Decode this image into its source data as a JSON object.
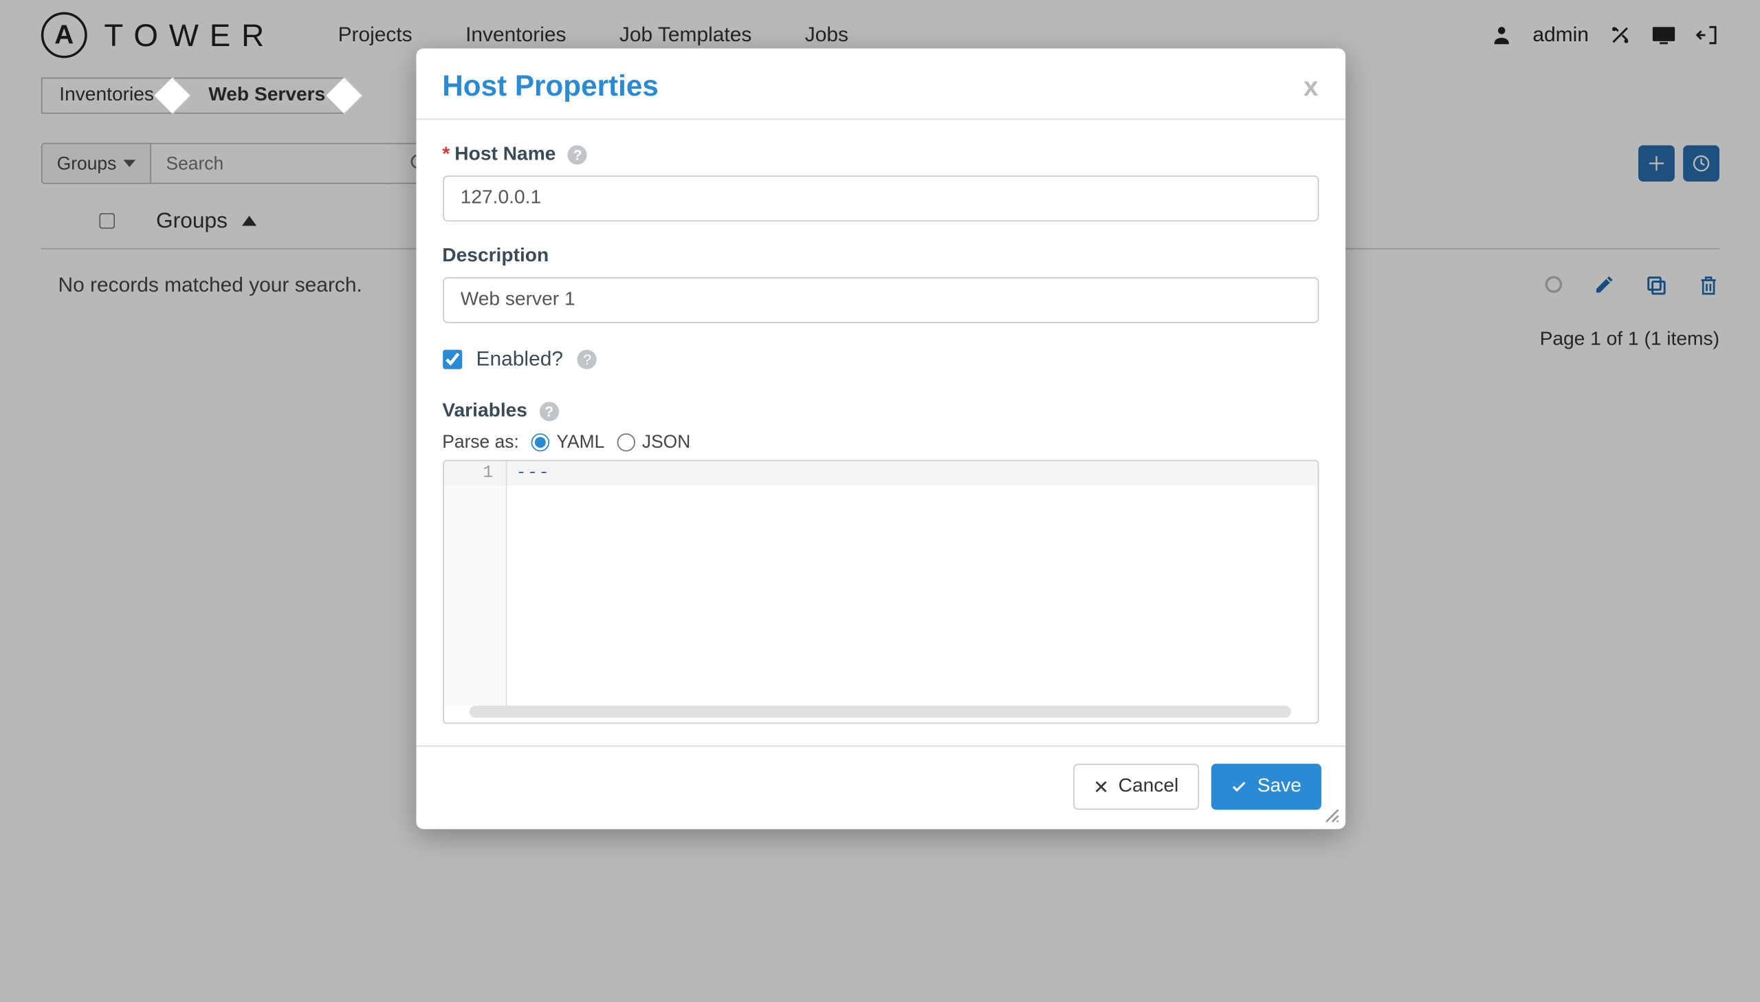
{
  "brand": {
    "mark": "A",
    "name": "TOWER"
  },
  "nav": {
    "projects": "Projects",
    "inventories": "Inventories",
    "job_templates": "Job Templates",
    "jobs": "Jobs"
  },
  "user": {
    "name": "admin"
  },
  "breadcrumb": {
    "root": "Inventories",
    "current": "Web Servers"
  },
  "toolbar": {
    "groups_label": "Groups",
    "search_placeholder": "Search"
  },
  "columns": {
    "groups": "Groups"
  },
  "empty_message": "No records matched your search.",
  "pagination": "Page 1 of 1 (1 items)",
  "modal": {
    "title": "Host Properties",
    "close": "x",
    "host_name_label": "Host Name",
    "host_name_value": "127.0.0.1",
    "description_label": "Description",
    "description_value": "Web server 1",
    "enabled_label": "Enabled?",
    "enabled_checked": true,
    "variables_label": "Variables",
    "parse_as_label": "Parse as:",
    "parse_yaml": "YAML",
    "parse_json": "JSON",
    "parse_selected": "YAML",
    "code_line_number": "1",
    "code_content": "---",
    "cancel": "Cancel",
    "save": "Save"
  }
}
